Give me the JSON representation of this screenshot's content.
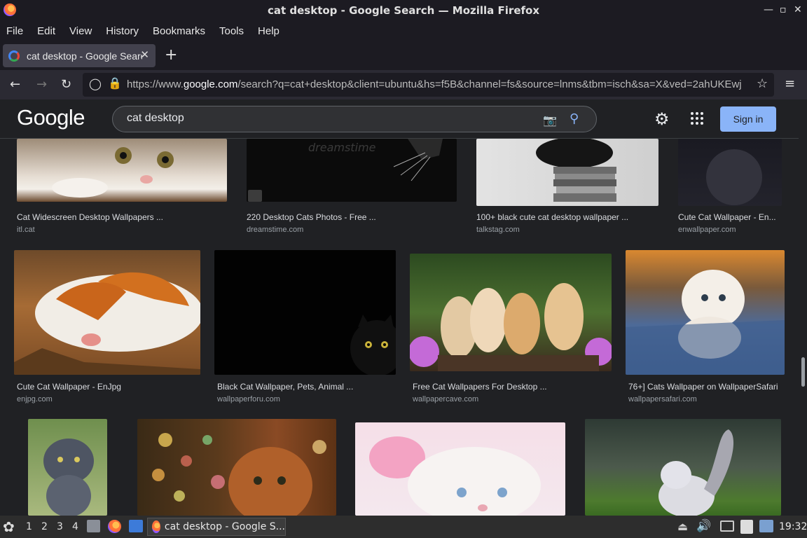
{
  "window": {
    "title": "cat desktop - Google Search — Mozilla Firefox"
  },
  "menu": [
    "File",
    "Edit",
    "View",
    "History",
    "Bookmarks",
    "Tools",
    "Help"
  ],
  "tab": {
    "label": "cat desktop - Google Search"
  },
  "url": {
    "prefix": "https://www.",
    "domain": "google.com",
    "rest": "/search?q=cat+desktop&client=ubuntu&hs=f5B&channel=fs&source=lnms&tbm=isch&sa=X&ved=2ahUKEwj"
  },
  "google": {
    "logo": "Google",
    "query": "cat desktop",
    "signin": "Sign in"
  },
  "results": [
    {
      "caption": "Cat Widescreen Desktop Wallpapers ...",
      "source": "itl.cat"
    },
    {
      "caption": "220 Desktop Cats Photos - Free ...",
      "source": "dreamstime.com"
    },
    {
      "caption": "100+ black cute cat desktop wallpaper ...",
      "source": "talkstag.com"
    },
    {
      "caption": "Cute Cat Wallpaper - En...",
      "source": "enwallpaper.com"
    },
    {
      "caption": "Cute Cat Wallpaper - EnJpg",
      "source": "enjpg.com"
    },
    {
      "caption": "Black Cat Wallpaper, Pets, Animal ...",
      "source": "wallpaperforu.com"
    },
    {
      "caption": "Free Cat Wallpapers For Desktop ...",
      "source": "wallpapercave.com"
    },
    {
      "caption": "76+] Cats Wallpaper on WallpaperSafari",
      "source": "wallpapersafari.com"
    }
  ],
  "image_watermark": "dreamstime",
  "taskbar": {
    "workspaces": [
      "1",
      "2",
      "3",
      "4"
    ],
    "window_label": "cat desktop - Google S...",
    "clock": "19:32"
  }
}
